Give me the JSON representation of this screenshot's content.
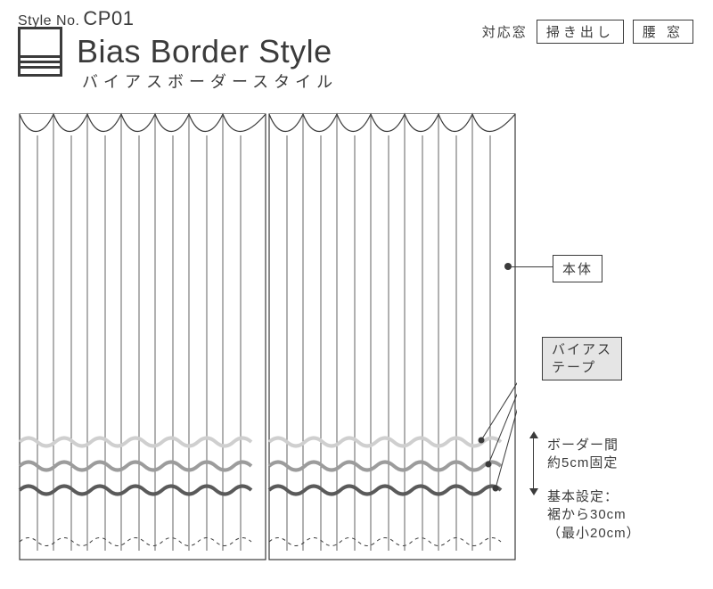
{
  "style_no_prefix": "Style No.",
  "style_no": "CP01",
  "title_en": "Bias Border Style",
  "title_jp": "バイアスボーダースタイル",
  "tags": {
    "label": "対応窓",
    "a": "掃き出し",
    "b": "腰 窓"
  },
  "callouts": {
    "body": "本体",
    "bias_tape": "バイアス\nテープ",
    "spacing": "ボーダー間\n約5cm固定",
    "baseline": "基本設定：\n裾から30cm\n（最小20cm）"
  }
}
